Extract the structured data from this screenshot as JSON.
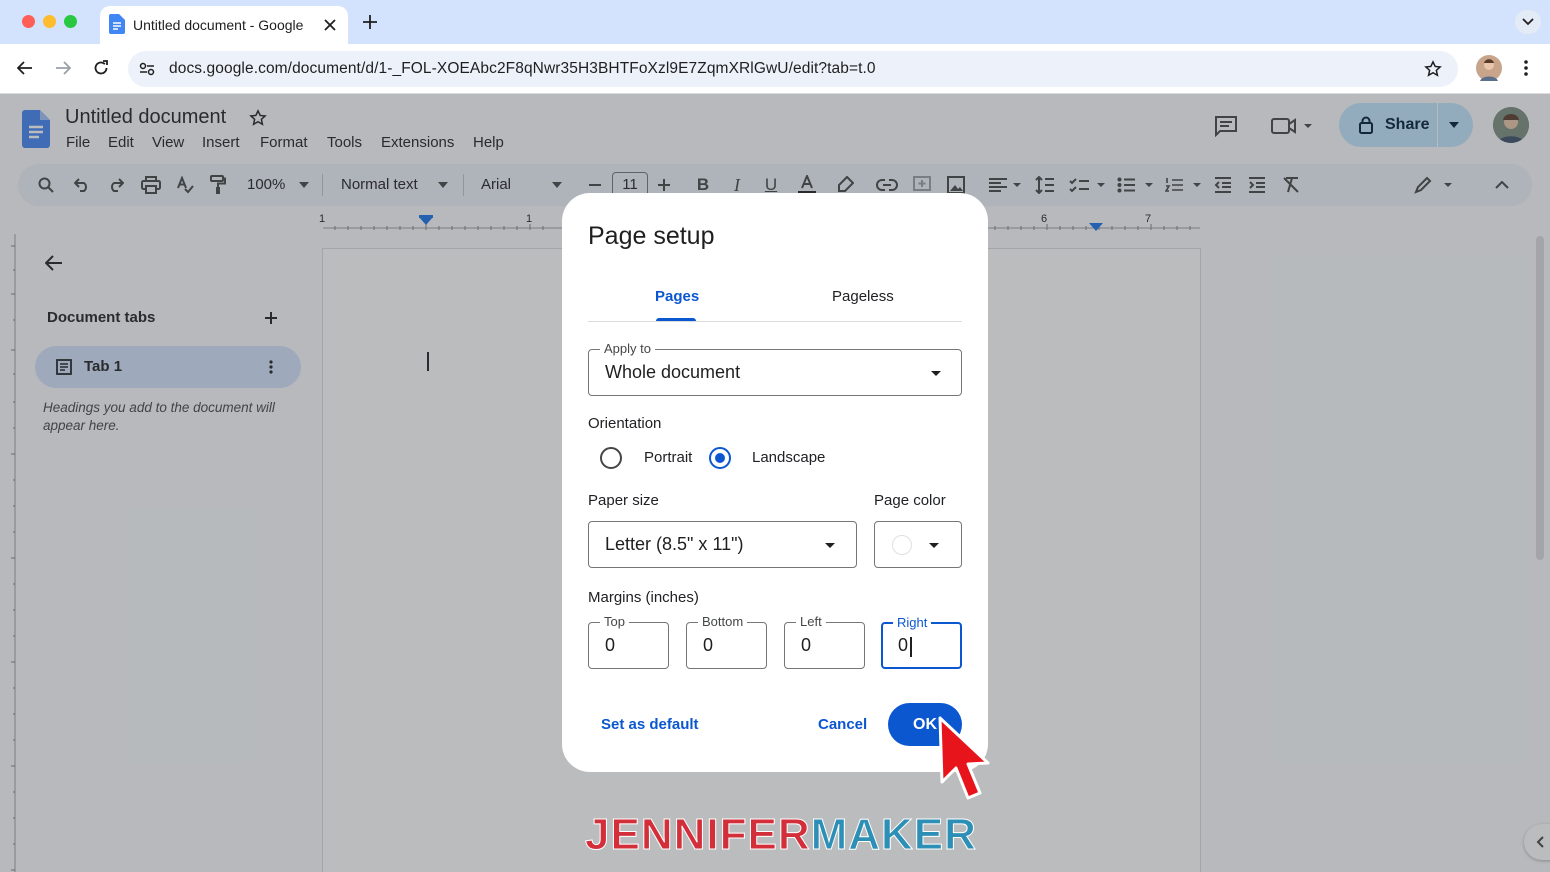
{
  "browser": {
    "tab_title": "Untitled document - Google Docs",
    "url": "docs.google.com/document/d/1-_FOL-XOEAbc2F8qNwr35H3BHTFoXzl9E7ZqmXRlGwU/edit?tab=t.0",
    "colors": {
      "close": "#ff5f57",
      "minimize": "#febc2e",
      "maximize": "#28c840",
      "docs_blue": "#4285f4"
    }
  },
  "docs": {
    "title": "Untitled document",
    "menu": [
      "File",
      "Edit",
      "View",
      "Insert",
      "Format",
      "Tools",
      "Extensions",
      "Help"
    ],
    "share_label": "Share",
    "toolbar": {
      "zoom": "100%",
      "style": "Normal text",
      "font": "Arial",
      "font_size": "11"
    },
    "ruler_numbers": [
      "1",
      "1",
      "6",
      "7"
    ],
    "sidebar": {
      "heading": "Document tabs",
      "tab_label": "Tab 1",
      "hint": "Headings you add to the document will appear here."
    }
  },
  "dialog": {
    "title": "Page setup",
    "tabs": [
      {
        "label": "Pages",
        "active": true
      },
      {
        "label": "Pageless",
        "active": false
      }
    ],
    "apply_to": {
      "label": "Apply to",
      "value": "Whole document"
    },
    "orientation": {
      "label": "Orientation",
      "options": [
        {
          "label": "Portrait",
          "selected": false
        },
        {
          "label": "Landscape",
          "selected": true
        }
      ]
    },
    "paper_size": {
      "label": "Paper size",
      "value": "Letter (8.5\" x 11\")"
    },
    "page_color": {
      "label": "Page color",
      "value": "#ffffff"
    },
    "margins": {
      "label": "Margins (inches)",
      "fields": [
        {
          "label": "Top",
          "value": "0"
        },
        {
          "label": "Bottom",
          "value": "0"
        },
        {
          "label": "Left",
          "value": "0"
        },
        {
          "label": "Right",
          "value": "0",
          "focused": true
        }
      ]
    },
    "buttons": {
      "set_default": "Set as default",
      "cancel": "Cancel",
      "ok": "OK"
    },
    "accent": "#0b57d0"
  },
  "watermark": {
    "part1": "JENNIFER",
    "part2": "MAKER",
    "color1": "#d32f3a",
    "color2": "#2d8fb5"
  }
}
